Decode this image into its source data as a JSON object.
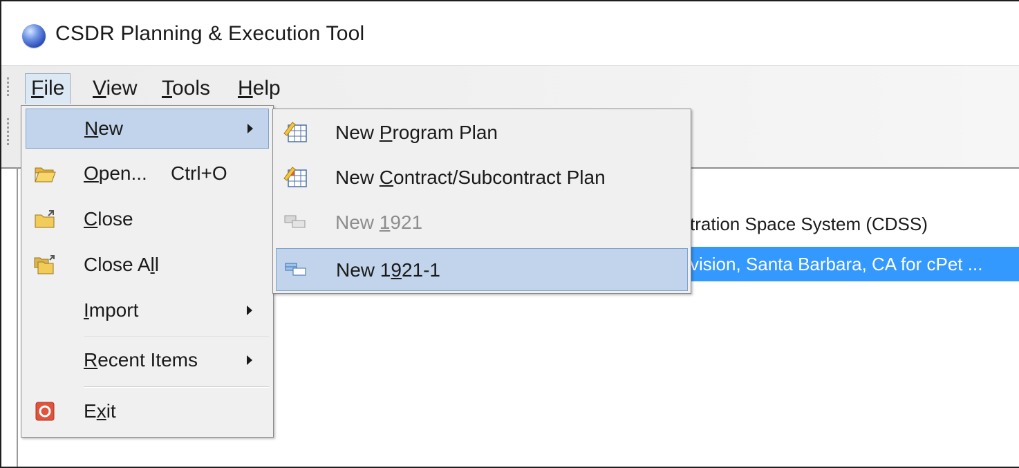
{
  "app": {
    "title": "CSDR Planning & Execution Tool",
    "icon": "app-globe-icon"
  },
  "menubar": [
    {
      "pre": "",
      "ul": "F",
      "post": "ile",
      "active": true
    },
    {
      "pre": "",
      "ul": "V",
      "post": "iew",
      "active": false
    },
    {
      "pre": "",
      "ul": "T",
      "post": "ools",
      "active": false
    },
    {
      "pre": "",
      "ul": "H",
      "post": "elp",
      "active": false
    }
  ],
  "file_menu": {
    "items": [
      {
        "pre": "",
        "ul": "N",
        "post": "ew",
        "shortcut": "",
        "icon": "",
        "submenu": true,
        "highlighted": true
      },
      {
        "pre": "",
        "ul": "O",
        "post": "pen...",
        "shortcut": "Ctrl+O",
        "icon": "open-folder-icon",
        "submenu": false,
        "highlighted": false
      },
      {
        "pre": "",
        "ul": "C",
        "post": "lose",
        "shortcut": "",
        "icon": "close-folder-icon",
        "submenu": false,
        "highlighted": false
      },
      {
        "pre": "Close A",
        "ul": "l",
        "post": "l",
        "shortcut": "",
        "icon": "close-all-folders-icon",
        "submenu": false,
        "highlighted": false
      },
      {
        "pre": "",
        "ul": "I",
        "post": "mport",
        "shortcut": "",
        "icon": "",
        "submenu": true,
        "highlighted": false
      },
      {
        "pre": "",
        "ul": "R",
        "post": "ecent Items",
        "shortcut": "",
        "icon": "",
        "submenu": true,
        "highlighted": false
      },
      {
        "pre": "E",
        "ul": "x",
        "post": "it",
        "shortcut": "",
        "icon": "exit-icon",
        "submenu": false,
        "highlighted": false
      }
    ]
  },
  "new_submenu": {
    "items": [
      {
        "pre": "New ",
        "ul": "P",
        "post": "rogram Plan",
        "icon": "program-plan-icon",
        "disabled": false,
        "highlighted": false
      },
      {
        "pre": "New ",
        "ul": "C",
        "post": "ontract/Subcontract Plan",
        "icon": "contract-plan-icon",
        "disabled": false,
        "highlighted": false
      },
      {
        "pre": "New ",
        "ul": "1",
        "post": "921",
        "icon": "form-1921-icon",
        "disabled": true,
        "highlighted": false
      },
      {
        "pre": "New 1",
        "ul": "9",
        "post": "21-1",
        "icon": "form-1921-1-icon",
        "disabled": false,
        "highlighted": true
      }
    ]
  },
  "tree": {
    "row1": "tration Space System (CDSS)",
    "row2": "vision, Santa Barbara, CA for cPet ..."
  },
  "colors": {
    "selection": "#3399ff",
    "menu_highlight": "#c2d4eb",
    "menu_bg": "#f0f0f0"
  }
}
